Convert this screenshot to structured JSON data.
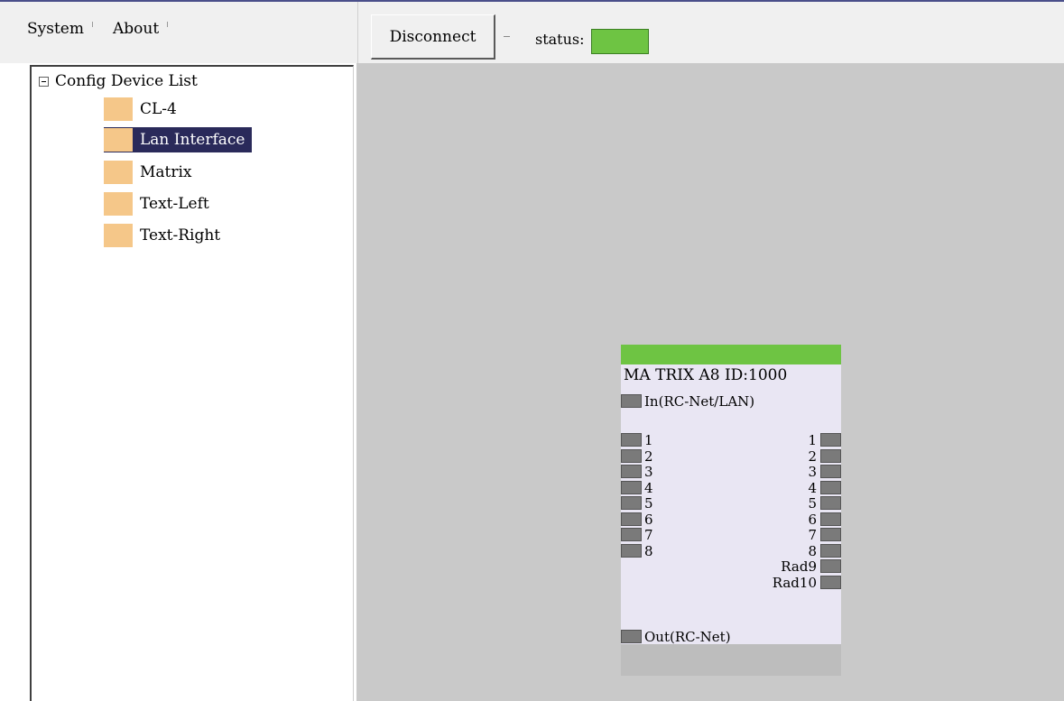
{
  "menu": [
    "System",
    "About"
  ],
  "toolbar": {
    "disconnect_label": "Disconnect",
    "status_label": "status:",
    "status_color": "#6ec443"
  },
  "tree": {
    "root_label": "Config Device List",
    "items": [
      {
        "label": "CL-4",
        "icon": "folder-icon"
      },
      {
        "label": "Lan Interface",
        "icon": "folder-icon",
        "selected": true
      },
      {
        "label": "Matrix",
        "icon": "folder-icon"
      },
      {
        "label": "Text-Left",
        "icon": "folder-icon"
      },
      {
        "label": "Text-Right",
        "icon": "folder-icon"
      }
    ]
  },
  "device": {
    "title": "MA TRIX A8  ID:1000",
    "in_label": "In(RC-Net/LAN)",
    "left_ports": [
      "1",
      "2",
      "3",
      "4",
      "5",
      "6",
      "7",
      "8"
    ],
    "right_ports": [
      "1",
      "2",
      "3",
      "4",
      "5",
      "6",
      "7",
      "8",
      "Rad9",
      "Rad10"
    ],
    "out_label": "Out(RC-Net)",
    "header_color": "#6ec443"
  }
}
